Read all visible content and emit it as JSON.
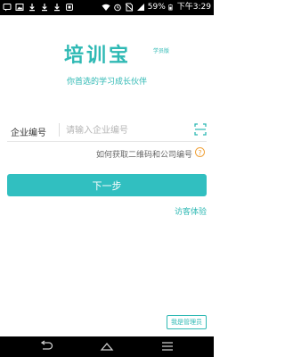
{
  "status_bar": {
    "battery_percent": "59%",
    "time": "下午3:29"
  },
  "app": {
    "logo_text": "培训宝",
    "logo_tag": "学员版",
    "slogan": "你首选的学习成长伙伴"
  },
  "form": {
    "company_code_label": "企业编号",
    "company_code_placeholder": "请输入企业编号",
    "company_code_value": "",
    "help_link": "如何获取二维码和公司编号",
    "help_icon_glyph": "?"
  },
  "actions": {
    "next_label": "下一步",
    "guest_label": "访客体验",
    "admin_label": "我是管理员"
  },
  "colors": {
    "accent": "#2fb9b4",
    "button": "#31bfc0",
    "help_icon": "#f0a23a"
  }
}
